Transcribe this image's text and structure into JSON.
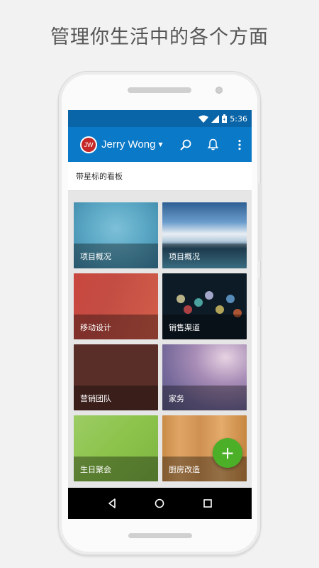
{
  "promo": {
    "headline": "管理你生活中的各个方面"
  },
  "status_bar": {
    "time": "5:36",
    "icons": [
      "wifi-icon",
      "signal-icon",
      "battery-icon"
    ]
  },
  "app_bar": {
    "avatar_initials": "JW",
    "avatar_color": "#c62828",
    "username": "Jerry Wong",
    "dropdown_caret": "▼",
    "actions": [
      "search-icon",
      "bell-icon",
      "more-vert-icon"
    ],
    "color": "#0a79c7"
  },
  "section": {
    "title": "带星标的看板"
  },
  "boards": [
    {
      "label": "项目概况"
    },
    {
      "label": "项目概况"
    },
    {
      "label": "移动设计"
    },
    {
      "label": "销售渠道"
    },
    {
      "label": "营销团队"
    },
    {
      "label": "家务"
    },
    {
      "label": "生日聚会"
    },
    {
      "label": "厨房改造"
    }
  ],
  "fab": {
    "symbol": "+",
    "color": "#4caf28"
  },
  "nav_bar": {
    "buttons": [
      "back-icon",
      "home-icon",
      "recents-icon"
    ]
  }
}
